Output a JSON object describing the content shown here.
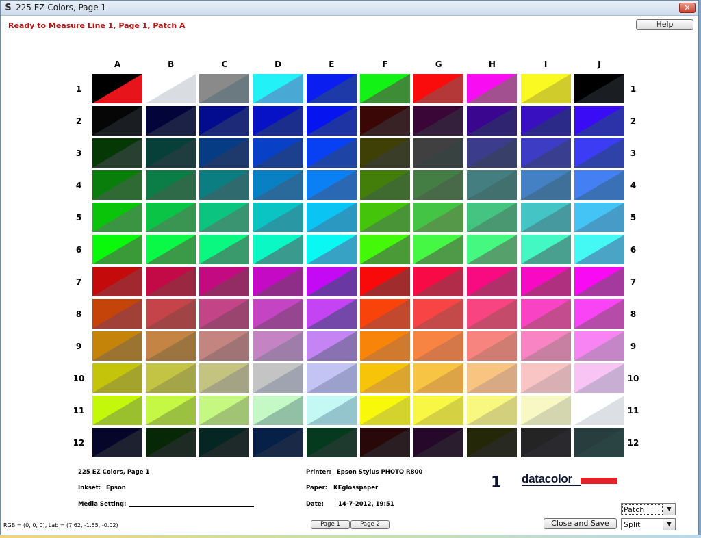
{
  "window": {
    "title": "225 EZ Colors, Page 1",
    "app_icon": "S",
    "close_glyph": "✕",
    "status": "Ready to Measure Line 1, Page 1, Patch A"
  },
  "buttons": {
    "help": "Help",
    "page1": "Page 1",
    "page2": "Page 2",
    "close_save": "Close and Save"
  },
  "dropdowns": {
    "mode": "Patch",
    "view": "Split"
  },
  "grid": {
    "columns": [
      "A",
      "B",
      "C",
      "D",
      "E",
      "F",
      "G",
      "H",
      "I",
      "J"
    ],
    "rows": [
      "1",
      "2",
      "3",
      "4",
      "5",
      "6",
      "7",
      "8",
      "9",
      "10",
      "11",
      "12"
    ],
    "patches": [
      [
        [
          "#000000",
          "#e8141c"
        ],
        [
          "#ffffff",
          "#d9dde2"
        ],
        [
          "#8a8a8a",
          "#6b7a80"
        ],
        [
          "#22f2f8",
          "#4aa8d4"
        ],
        [
          "#0a1ef0",
          "#1e3aa8"
        ],
        [
          "#12f214",
          "#3f8c36"
        ],
        [
          "#fa0c0c",
          "#b43838"
        ],
        [
          "#f80cf2",
          "#a2508e"
        ],
        [
          "#fafa22",
          "#cfcc2c"
        ],
        [
          "#000000",
          "#1a1e22"
        ]
      ],
      [
        [
          "#060606",
          "#1a1e22"
        ],
        [
          "#03053a",
          "#1c2246"
        ],
        [
          "#030c8e",
          "#1c2a78"
        ],
        [
          "#0712c6",
          "#1b2e8c"
        ],
        [
          "#0614f0",
          "#1e34a2"
        ],
        [
          "#3a0606",
          "#382226"
        ],
        [
          "#3a0638",
          "#34203c"
        ],
        [
          "#3a0690",
          "#2e2470"
        ],
        [
          "#3810c0",
          "#2c2a88"
        ],
        [
          "#3a0cf6",
          "#2c32a8"
        ]
      ],
      [
        [
          "#063806",
          "#284030"
        ],
        [
          "#064038",
          "#1f3c3e"
        ],
        [
          "#063c84",
          "#1e3a6c"
        ],
        [
          "#0840c8",
          "#1c3f8e"
        ],
        [
          "#0840f4",
          "#1e44a6"
        ],
        [
          "#3e4006",
          "#3a3e28"
        ],
        [
          "#404040",
          "#384240"
        ],
        [
          "#3c3c8c",
          "#38406a"
        ],
        [
          "#3c3cc4",
          "#3a3e8e"
        ],
        [
          "#3c3cf4",
          "#2e42a8"
        ]
      ],
      [
        [
          "#0a7e0a",
          "#2f6a34"
        ],
        [
          "#0a7e46",
          "#2f6a48"
        ],
        [
          "#0a7e80",
          "#2e6a6e"
        ],
        [
          "#0a80c4",
          "#2a6a9a"
        ],
        [
          "#0a80f4",
          "#2a68b4"
        ],
        [
          "#447e0a",
          "#3f6a30"
        ],
        [
          "#447e44",
          "#486a48"
        ],
        [
          "#447e80",
          "#42706e"
        ],
        [
          "#4480c4",
          "#3f709a"
        ],
        [
          "#4480f4",
          "#3a70b6"
        ]
      ],
      [
        [
          "#0ac40a",
          "#3a9442"
        ],
        [
          "#0ac446",
          "#3a9452"
        ],
        [
          "#0ac480",
          "#3a9472"
        ],
        [
          "#0ac4c4",
          "#2a98a4"
        ],
        [
          "#0ac4f4",
          "#2a98c0"
        ],
        [
          "#44c40a",
          "#4a9438"
        ],
        [
          "#44c444",
          "#56984a"
        ],
        [
          "#44c480",
          "#4a9872"
        ],
        [
          "#44c4c4",
          "#46999e"
        ],
        [
          "#44c4f4",
          "#469cc6"
        ]
      ],
      [
        [
          "#0af80a",
          "#3a9a38"
        ],
        [
          "#0af846",
          "#3a9a48"
        ],
        [
          "#0af880",
          "#3a9a6c"
        ],
        [
          "#0af8c4",
          "#3a9a8e"
        ],
        [
          "#0af8f4",
          "#38a2c4"
        ],
        [
          "#44f80a",
          "#4a9a38"
        ],
        [
          "#44f844",
          "#4e9a48"
        ],
        [
          "#44f880",
          "#56a06c"
        ],
        [
          "#44f8c4",
          "#4aa08e"
        ],
        [
          "#44f8f4",
          "#4aa4c6"
        ]
      ],
      [
        [
          "#c40a0a",
          "#a0282e"
        ],
        [
          "#c40a46",
          "#9a2840"
        ],
        [
          "#c40a80",
          "#922c62"
        ],
        [
          "#c40ac4",
          "#8e2e88"
        ],
        [
          "#c40af4",
          "#6a38a2"
        ],
        [
          "#f80a0a",
          "#a02c2e"
        ],
        [
          "#f80a46",
          "#b02c48"
        ],
        [
          "#f80a80",
          "#b0306a"
        ],
        [
          "#f80ac4",
          "#b03080"
        ],
        [
          "#f80af4",
          "#a43a9e"
        ]
      ],
      [
        [
          "#c4440a",
          "#a04036"
        ],
        [
          "#c4444a",
          "#a04446"
        ],
        [
          "#c44488",
          "#9a4470"
        ],
        [
          "#c444c4",
          "#964690"
        ],
        [
          "#c444f4",
          "#7448a8"
        ],
        [
          "#f8440a",
          "#c2482e"
        ],
        [
          "#f84444",
          "#c44a4a"
        ],
        [
          "#f84480",
          "#c44c6a"
        ],
        [
          "#f844c4",
          "#c24c8e"
        ],
        [
          "#f844f4",
          "#b44ca8"
        ]
      ],
      [
        [
          "#c4840a",
          "#9c7432"
        ],
        [
          "#c48444",
          "#9c7440"
        ],
        [
          "#c48480",
          "#a07474"
        ],
        [
          "#c484c4",
          "#9e7ea8"
        ],
        [
          "#c484f4",
          "#8a72b2"
        ],
        [
          "#f8840a",
          "#d07a2e"
        ],
        [
          "#f88444",
          "#d4784a"
        ],
        [
          "#f88480",
          "#cf7c72"
        ],
        [
          "#f884c4",
          "#c780a2"
        ],
        [
          "#f884f4",
          "#c486c6"
        ]
      ],
      [
        [
          "#c4c40a",
          "#a4a42c"
        ],
        [
          "#c4c444",
          "#a4a448"
        ],
        [
          "#c4c480",
          "#a4a484"
        ],
        [
          "#c4c4c4",
          "#a0a4b0"
        ],
        [
          "#c4c4f4",
          "#9ca0cc"
        ],
        [
          "#f8c40a",
          "#dca52e"
        ],
        [
          "#f8c444",
          "#dca446"
        ],
        [
          "#f8c480",
          "#d8aa84"
        ],
        [
          "#f8c4c4",
          "#d8b0b4"
        ],
        [
          "#f8c4f4",
          "#c8aed2"
        ]
      ],
      [
        [
          "#c4f80a",
          "#9ac02e"
        ],
        [
          "#c4f844",
          "#9cc040"
        ],
        [
          "#c4f880",
          "#a0c474"
        ],
        [
          "#c4f8c4",
          "#92c0a4"
        ],
        [
          "#c4f8f4",
          "#94c4cc"
        ],
        [
          "#f8f80a",
          "#d4d22c"
        ],
        [
          "#f8f844",
          "#d4d242"
        ],
        [
          "#f8f880",
          "#d2d07c"
        ],
        [
          "#f8f8c4",
          "#d4d6b0"
        ],
        [
          "#ffffff",
          "#dcdfe4"
        ]
      ],
      [
        [
          "#06062a",
          "#1e2230"
        ],
        [
          "#062806",
          "#1e2a24"
        ],
        [
          "#062624",
          "#1e2a2a"
        ],
        [
          "#062048",
          "#1a2a46"
        ],
        [
          "#063a1e",
          "#1e3a2e"
        ],
        [
          "#280808",
          "#2a1e22"
        ],
        [
          "#26082a",
          "#2a1e2e"
        ],
        [
          "#242808",
          "#282a22"
        ],
        [
          "#242424",
          "#2a2a2e"
        ],
        [
          "#283e3e",
          "#2a4444"
        ]
      ]
    ]
  },
  "footer": {
    "chart_name": "225 EZ Colors, Page 1",
    "inkset_label": "Inkset:",
    "inkset_value": "Epson",
    "media_label": "Media Setting:",
    "printer_label": "Printer:",
    "printer_value": "Epson Stylus PHOTO R800",
    "paper_label": "Paper:",
    "paper_value": "KEglosspaper",
    "date_label": "Date:",
    "date_value": "14-7-2012, 19:51",
    "page_number": "1",
    "logo_text": "datacolor"
  },
  "readout": "RGB = (0, 0, 0), Lab = (7.62, -1.55, -0.02)"
}
